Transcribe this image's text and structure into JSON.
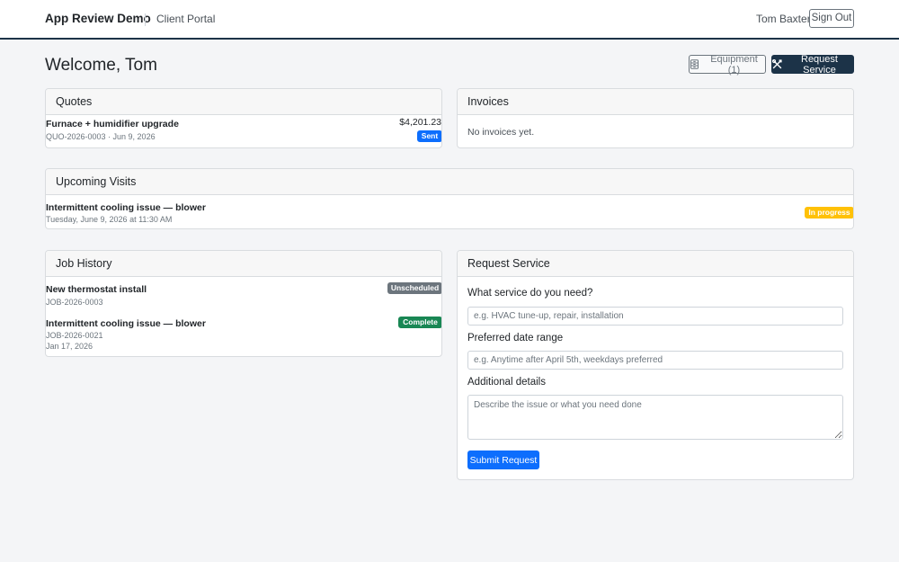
{
  "navbar": {
    "brand": "App Review Demo",
    "subtitle": "Client Portal",
    "user_name": "Tom Baxter",
    "sign_out_label": "Sign Out"
  },
  "header": {
    "title": "Welcome, Tom",
    "equipment_label": "Equipment (1)",
    "request_service_label": "Request Service"
  },
  "quotes": {
    "title": "Quotes",
    "items": [
      {
        "name": "Furnace + humidifier upgrade",
        "meta": "QUO-2026-0003 · Jun 9, 2026",
        "amount": "$4,201.23",
        "status": "Sent"
      }
    ]
  },
  "invoices": {
    "title": "Invoices",
    "empty_text": "No invoices yet."
  },
  "upcoming_visits": {
    "title": "Upcoming Visits",
    "items": [
      {
        "name": "Intermittent cooling issue — blower",
        "meta": "Tuesday, June 9, 2026 at 11:30 AM",
        "status": "In progress"
      }
    ]
  },
  "job_history": {
    "title": "Job History",
    "items": [
      {
        "name": "New thermostat install",
        "meta": "JOB-2026-0003",
        "status": "Unscheduled"
      },
      {
        "name": "Intermittent cooling issue — blower",
        "meta": "JOB-2026-0021",
        "date": "Jan 17, 2026",
        "status": "Complete"
      }
    ]
  },
  "request_form": {
    "title": "Request Service",
    "service_label": "What service do you need?",
    "service_placeholder": "e.g. HVAC tune-up, repair, installation",
    "date_label": "Preferred date range",
    "date_placeholder": "e.g. Anytime after April 5th, weekdays preferred",
    "details_label": "Additional details",
    "details_placeholder": "Describe the issue or what you need done",
    "submit_label": "Submit Request"
  },
  "colors": {
    "navy": "#1c3348",
    "primary": "#0d6efd",
    "warning": "#ffc107",
    "secondary": "#6c757d",
    "success": "#198754"
  },
  "icons": {
    "equipment": "equipment-icon",
    "request_service": "tools-icon"
  }
}
